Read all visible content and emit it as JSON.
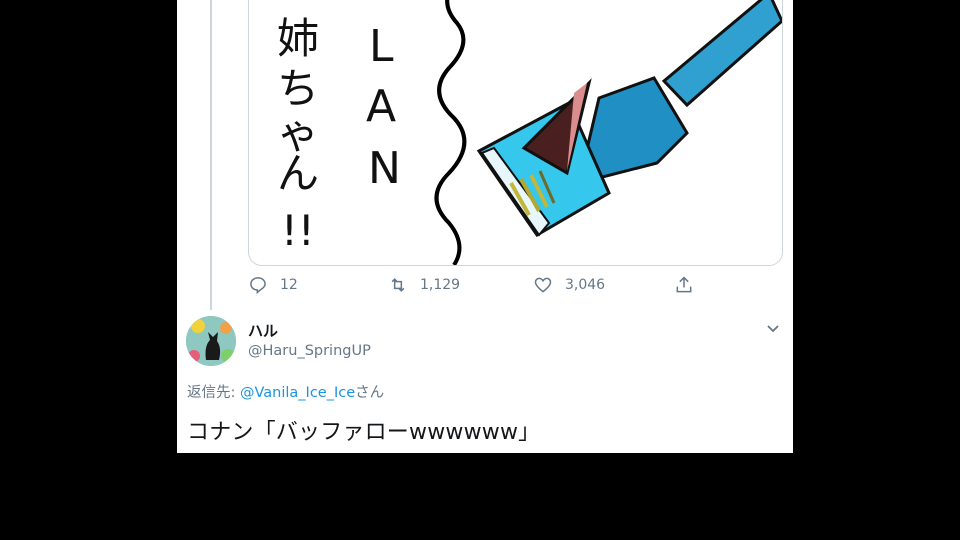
{
  "embedded_tweet": {
    "image_text": {
      "vertical_1": "姉ちゃん!!",
      "vertical_2": "LAN"
    },
    "actions": {
      "reply_count": "12",
      "retweet_count": "1,129",
      "like_count": "3,046"
    }
  },
  "reply": {
    "display_name": "ハル",
    "handle": "@Haru_SpringUP",
    "replying_prefix": "返信先: ",
    "replying_mention": "@Vanila_Ice_Ice",
    "replying_suffix": "さん",
    "text": "コナン「バッファローwwwwww」"
  },
  "colors": {
    "link": "#1b95e0",
    "muted": "#657786",
    "cable": "#2fa0cf"
  }
}
